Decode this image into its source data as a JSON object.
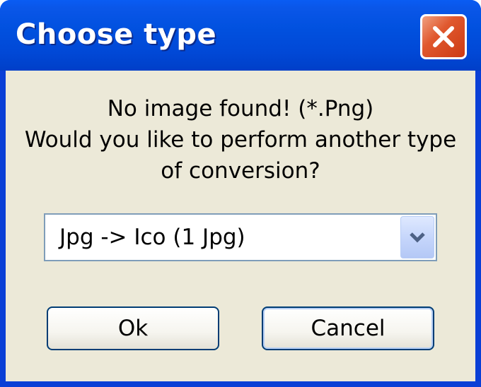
{
  "window": {
    "title": "Choose type",
    "close_icon": "close-icon"
  },
  "message": {
    "line1": "No image found! (*.Png)",
    "line2": "Would you like to perform another type",
    "line3": "of conversion?"
  },
  "conversion_select": {
    "selected": "Jpg -> Ico (1 Jpg)",
    "arrow_icon": "chevron-down-icon"
  },
  "buttons": {
    "ok_label": "Ok",
    "cancel_label": "Cancel"
  },
  "colors": {
    "titlebar": "#0151df",
    "client_bg": "#ece9d8",
    "close_button": "#e0582e",
    "button_border": "#003c74"
  }
}
